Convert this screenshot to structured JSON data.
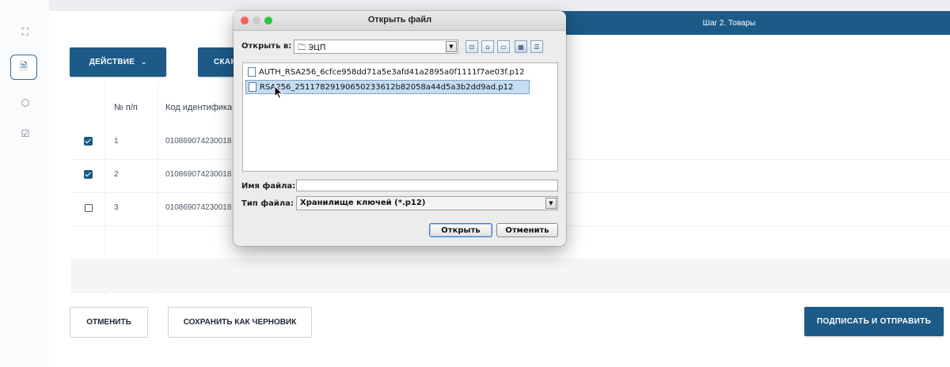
{
  "rail": {
    "icons": [
      "expand-icon",
      "document-icon",
      "box-icon",
      "check-square-icon"
    ]
  },
  "stepper": {
    "step2": "Шаг 2. Товары"
  },
  "toolbar": {
    "action_label": "ДЕЙСТВИЕ",
    "scan_label": "СКАН"
  },
  "table": {
    "headers": [
      "№ п/п",
      "Код идентифика"
    ],
    "rows": [
      {
        "checked": true,
        "num": "1",
        "code": "010869074230018"
      },
      {
        "checked": true,
        "num": "2",
        "code": "010869074230018"
      },
      {
        "checked": false,
        "num": "3",
        "code": "010869074230018"
      }
    ]
  },
  "footer": {
    "cancel_label": "ОТМЕНИТЬ",
    "draft_label": "СОХРАНИТЬ КАК ЧЕРНОВИК",
    "sign_label": "ПОДПИСАТЬ И ОТПРАВИТЬ"
  },
  "dialog": {
    "title": "Открыть файл",
    "look_in_label": "Открыть в:",
    "look_in_value": "ЭЦП",
    "files": [
      "AUTH_RSA256_6cfce958dd71a5e3afd41a2895a0f1111f7ae03f.p12",
      "RSA256_2511782919065023361​2b82058a44d5a3b2dd9ad.p12"
    ],
    "selected_index": 1,
    "filename_label": "Имя файла:",
    "filename_value": "",
    "filetype_label": "Тип файла:",
    "filetype_value": "Хранилище ключей (*.p12)",
    "open_label": "Открыть",
    "cancel_label": "Отменить"
  },
  "colors": {
    "brand": "#1c5a87",
    "traffic_red": "#fe5f57",
    "traffic_gray": "#c9c9c9",
    "traffic_green": "#28c840"
  }
}
